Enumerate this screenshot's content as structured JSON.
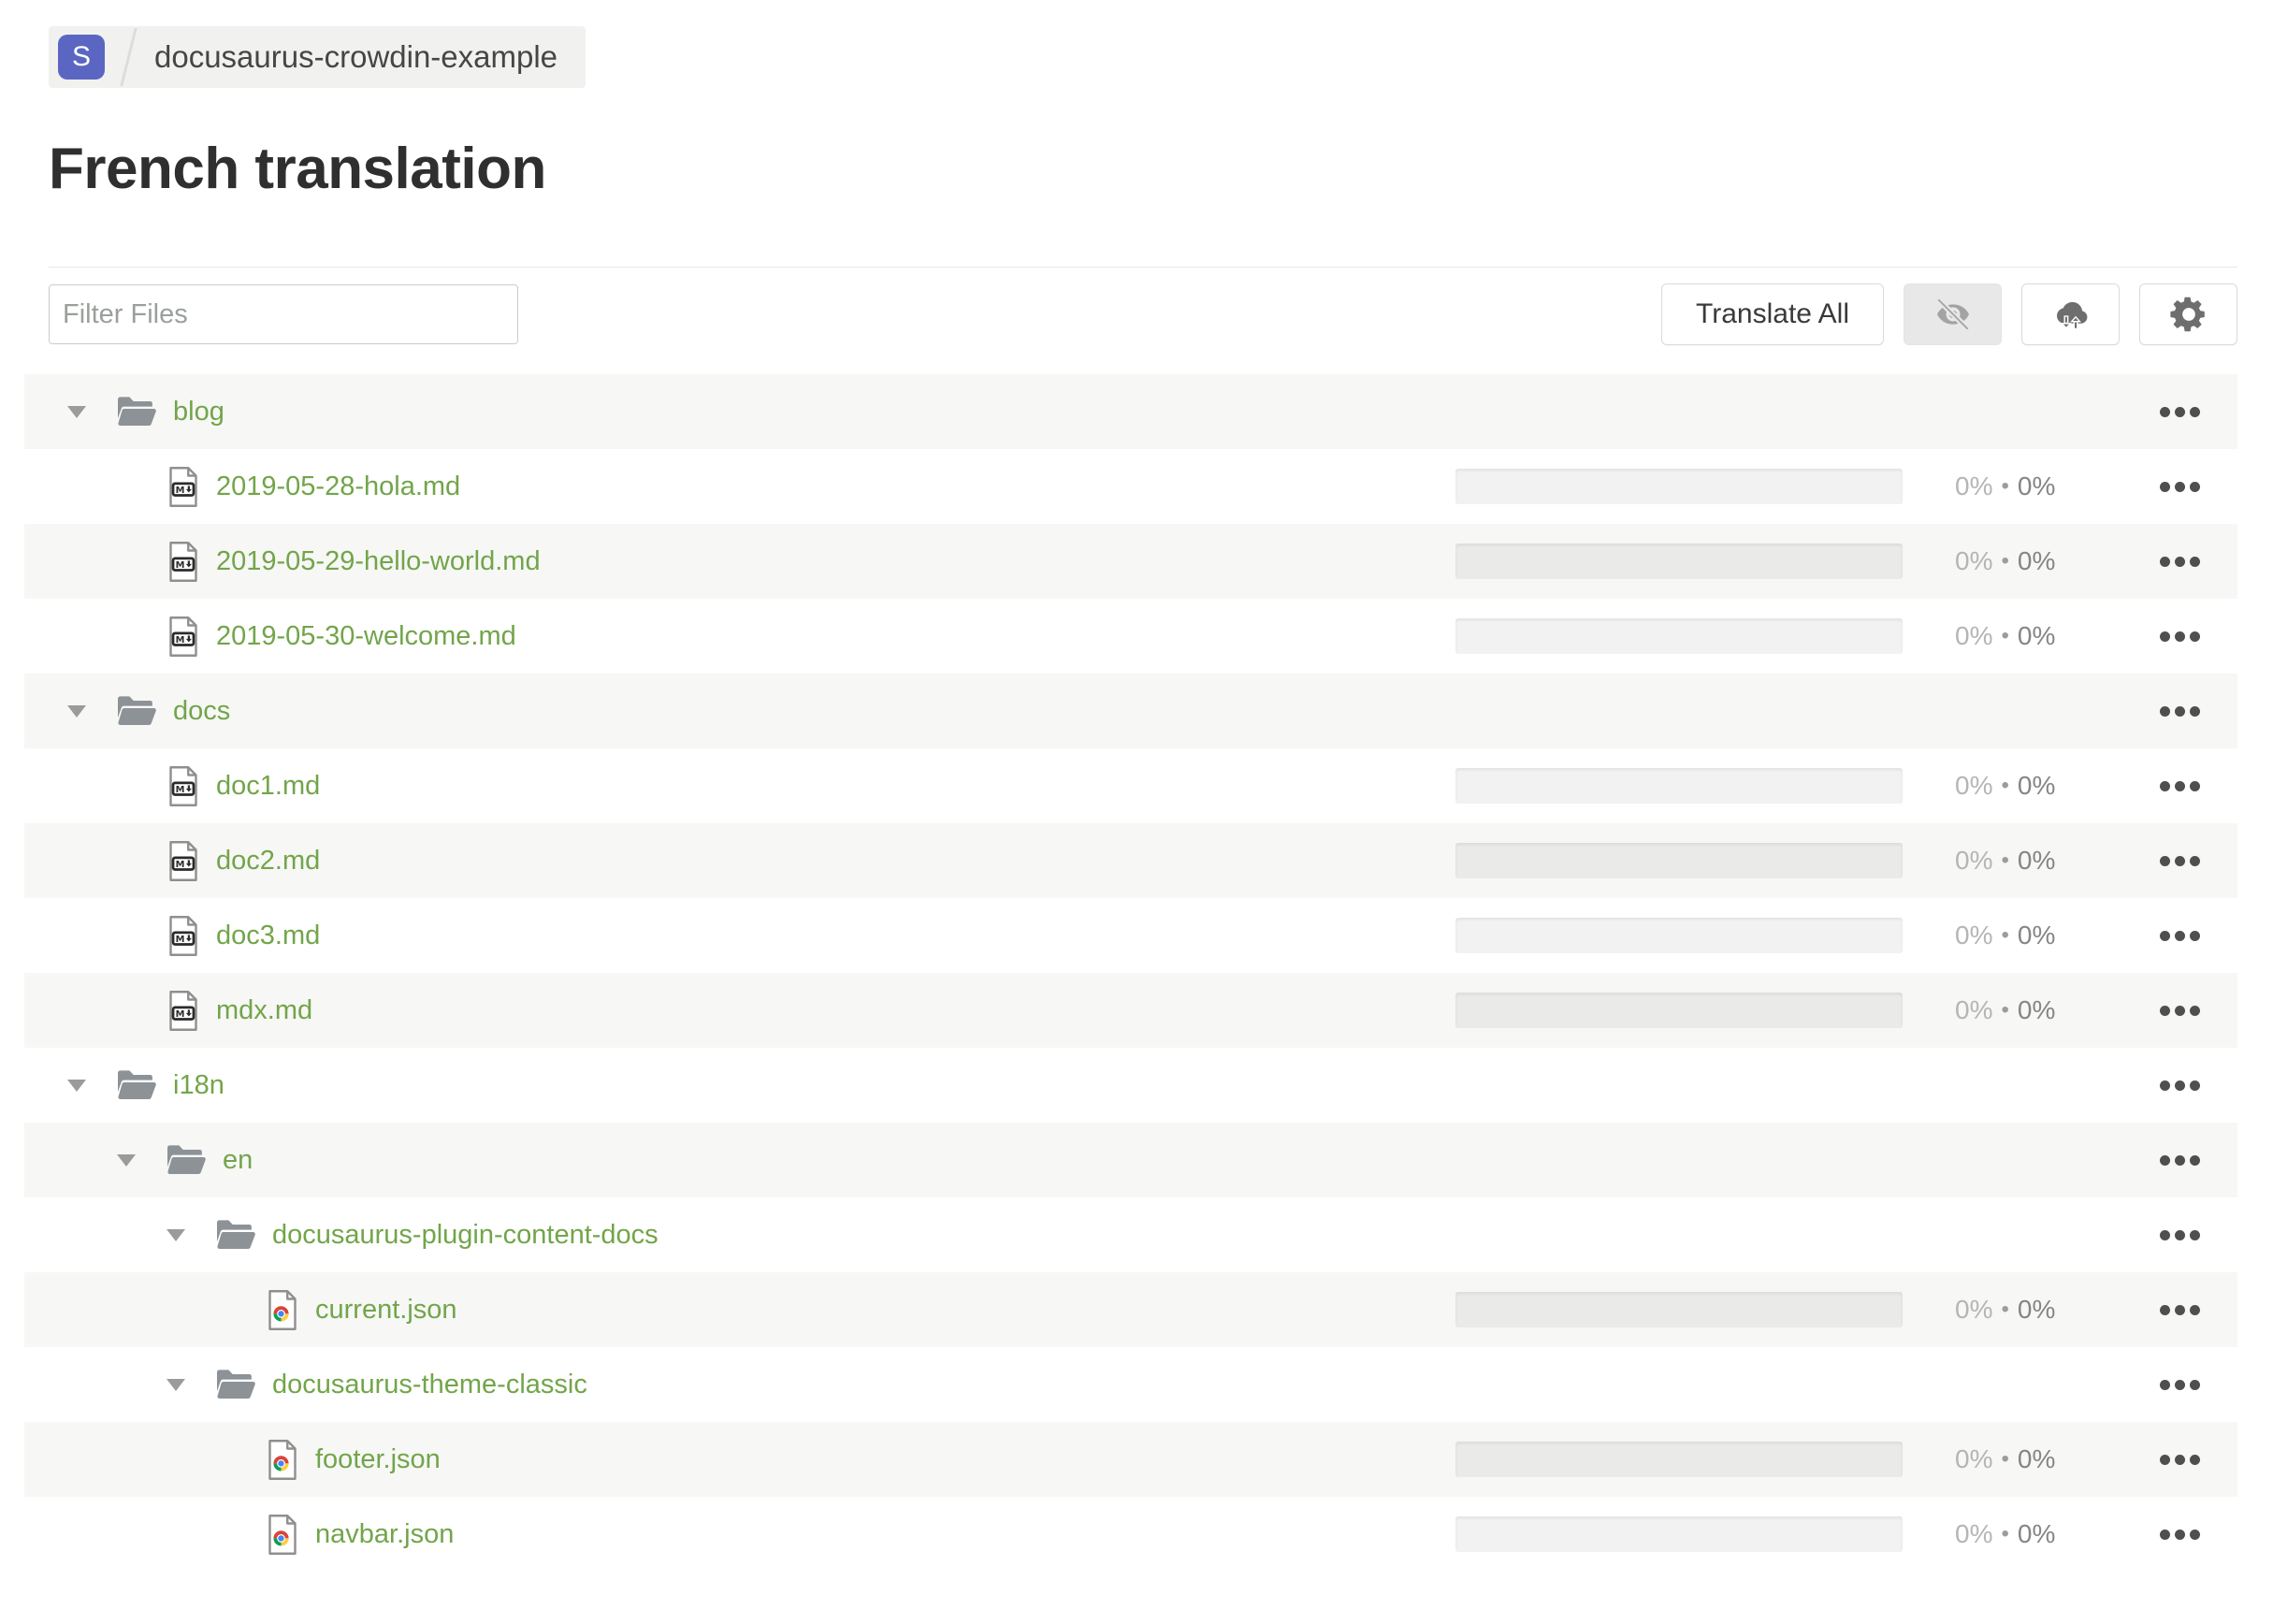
{
  "breadcrumb": {
    "project_initial": "S",
    "project_name": "docusaurus-crowdin-example"
  },
  "page": {
    "title": "French translation"
  },
  "toolbar": {
    "filter_placeholder": "Filter Files",
    "translate_all_label": "Translate All",
    "buttons": [
      {
        "name": "hide-completed-button",
        "icon": "eye-off-icon",
        "active": true
      },
      {
        "name": "download-upload-button",
        "icon": "cloud-sync-icon",
        "active": false
      },
      {
        "name": "settings-button",
        "icon": "gear-icon",
        "active": false
      }
    ]
  },
  "colors": {
    "accent_green": "#72a54a",
    "badge_indigo": "#5b66c3",
    "row_alt_bg": "#f7f7f6",
    "chip_bg": "#f1f1f0"
  },
  "stats_separator": "•",
  "file_tree": {
    "rows": [
      {
        "type": "folder",
        "icon": "folder-icon",
        "name": "blog",
        "depth": 0
      },
      {
        "type": "file",
        "icon": "markdown-file-icon",
        "name": "2019-05-28-hola.md",
        "depth": 1,
        "translated": "0%",
        "approved": "0%"
      },
      {
        "type": "file",
        "icon": "markdown-file-icon",
        "name": "2019-05-29-hello-world.md",
        "depth": 1,
        "translated": "0%",
        "approved": "0%"
      },
      {
        "type": "file",
        "icon": "markdown-file-icon",
        "name": "2019-05-30-welcome.md",
        "depth": 1,
        "translated": "0%",
        "approved": "0%"
      },
      {
        "type": "folder",
        "icon": "folder-icon",
        "name": "docs",
        "depth": 0
      },
      {
        "type": "file",
        "icon": "markdown-file-icon",
        "name": "doc1.md",
        "depth": 1,
        "translated": "0%",
        "approved": "0%"
      },
      {
        "type": "file",
        "icon": "markdown-file-icon",
        "name": "doc2.md",
        "depth": 1,
        "translated": "0%",
        "approved": "0%"
      },
      {
        "type": "file",
        "icon": "markdown-file-icon",
        "name": "doc3.md",
        "depth": 1,
        "translated": "0%",
        "approved": "0%"
      },
      {
        "type": "file",
        "icon": "markdown-file-icon",
        "name": "mdx.md",
        "depth": 1,
        "translated": "0%",
        "approved": "0%"
      },
      {
        "type": "folder",
        "icon": "folder-icon",
        "name": "i18n",
        "depth": 0
      },
      {
        "type": "folder",
        "icon": "folder-icon",
        "name": "en",
        "depth": 1
      },
      {
        "type": "folder",
        "icon": "folder-icon",
        "name": "docusaurus-plugin-content-docs",
        "depth": 2
      },
      {
        "type": "file",
        "icon": "json-file-icon",
        "name": "current.json",
        "depth": 3,
        "translated": "0%",
        "approved": "0%"
      },
      {
        "type": "folder",
        "icon": "folder-icon",
        "name": "docusaurus-theme-classic",
        "depth": 2
      },
      {
        "type": "file",
        "icon": "json-file-icon",
        "name": "footer.json",
        "depth": 3,
        "translated": "0%",
        "approved": "0%"
      },
      {
        "type": "file",
        "icon": "json-file-icon",
        "name": "navbar.json",
        "depth": 3,
        "translated": "0%",
        "approved": "0%"
      }
    ]
  }
}
